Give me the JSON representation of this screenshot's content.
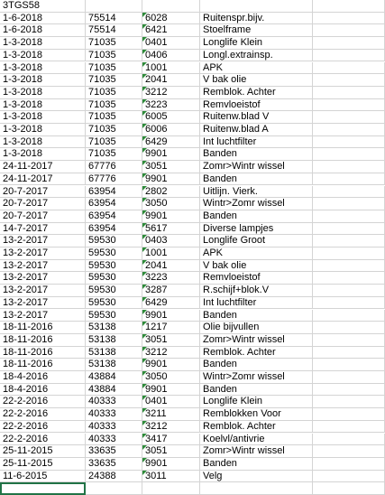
{
  "header_row": [
    "3TGS58",
    "",
    "",
    "",
    ""
  ],
  "rows": [
    [
      "1-6-2018",
      "75514",
      "6028",
      "Ruitenspr.bijv.",
      ""
    ],
    [
      "1-6-2018",
      "75514",
      "6421",
      "Stoelframe",
      ""
    ],
    [
      "1-3-2018",
      "71035",
      "0401",
      "Longlife Klein",
      ""
    ],
    [
      "1-3-2018",
      "71035",
      "0406",
      "Longl.extrainsp.",
      ""
    ],
    [
      "1-3-2018",
      "71035",
      "1001",
      "APK",
      ""
    ],
    [
      "1-3-2018",
      "71035",
      "2041",
      "V bak olie",
      ""
    ],
    [
      "1-3-2018",
      "71035",
      "3212",
      "Remblok. Achter",
      ""
    ],
    [
      "1-3-2018",
      "71035",
      "3223",
      "Remvloeistof",
      ""
    ],
    [
      "1-3-2018",
      "71035",
      "6005",
      "Ruitenw.blad V",
      ""
    ],
    [
      "1-3-2018",
      "71035",
      "6006",
      "Ruitenw.blad A",
      ""
    ],
    [
      "1-3-2018",
      "71035",
      "6429",
      "Int luchtfilter",
      ""
    ],
    [
      "1-3-2018",
      "71035",
      "9901",
      "Banden",
      ""
    ],
    [
      "24-11-2017",
      "67776",
      "3051",
      "Zomr>Wintr wissel",
      ""
    ],
    [
      "24-11-2017",
      "67776",
      "9901",
      "Banden",
      ""
    ],
    [
      "20-7-2017",
      "63954",
      "2802",
      "Uitlijn. Vierk.",
      ""
    ],
    [
      "20-7-2017",
      "63954",
      "3050",
      "Wintr>Zomr wissel",
      ""
    ],
    [
      "20-7-2017",
      "63954",
      "9901",
      "Banden",
      ""
    ],
    [
      "14-7-2017",
      "63954",
      "5617",
      "Diverse lampjes",
      ""
    ],
    [
      "13-2-2017",
      "59530",
      "0403",
      "Longlife Groot",
      ""
    ],
    [
      "13-2-2017",
      "59530",
      "1001",
      "APK",
      ""
    ],
    [
      "13-2-2017",
      "59530",
      "2041",
      "V bak olie",
      ""
    ],
    [
      "13-2-2017",
      "59530",
      "3223",
      "Remvloeistof",
      ""
    ],
    [
      "13-2-2017",
      "59530",
      "3287",
      "R.schijf+blok.V",
      ""
    ],
    [
      "13-2-2017",
      "59530",
      "6429",
      "Int luchtfilter",
      ""
    ],
    [
      "13-2-2017",
      "59530",
      "9901",
      "Banden",
      ""
    ],
    [
      "18-11-2016",
      "53138",
      "1217",
      "Olie bijvullen",
      ""
    ],
    [
      "18-11-2016",
      "53138",
      "3051",
      "Zomr>Wintr wissel",
      ""
    ],
    [
      "18-11-2016",
      "53138",
      "3212",
      "Remblok. Achter",
      ""
    ],
    [
      "18-11-2016",
      "53138",
      "9901",
      "Banden",
      ""
    ],
    [
      "18-4-2016",
      "43884",
      "3050",
      "Wintr>Zomr wissel",
      ""
    ],
    [
      "18-4-2016",
      "43884",
      "9901",
      "Banden",
      ""
    ],
    [
      "22-2-2016",
      "40333",
      "0401",
      "Longlife Klein",
      ""
    ],
    [
      "22-2-2016",
      "40333",
      "3211",
      "Remblokken Voor",
      ""
    ],
    [
      "22-2-2016",
      "40333",
      "3212",
      "Remblok. Achter",
      ""
    ],
    [
      "22-2-2016",
      "40333",
      "3417",
      "Koelvl/antivrie",
      ""
    ],
    [
      "25-11-2015",
      "33635",
      "3051",
      "Zomr>Wintr wissel",
      ""
    ],
    [
      "25-11-2015",
      "33635",
      "9901",
      "Banden",
      ""
    ],
    [
      "11-6-2015",
      "24388",
      "3011",
      "Velg",
      ""
    ],
    [
      "",
      "",
      "",
      "",
      ""
    ]
  ],
  "colors": {
    "gridline": "#d4d4d4",
    "error_triangle": "#2e8b3a",
    "selection": "#217346"
  }
}
